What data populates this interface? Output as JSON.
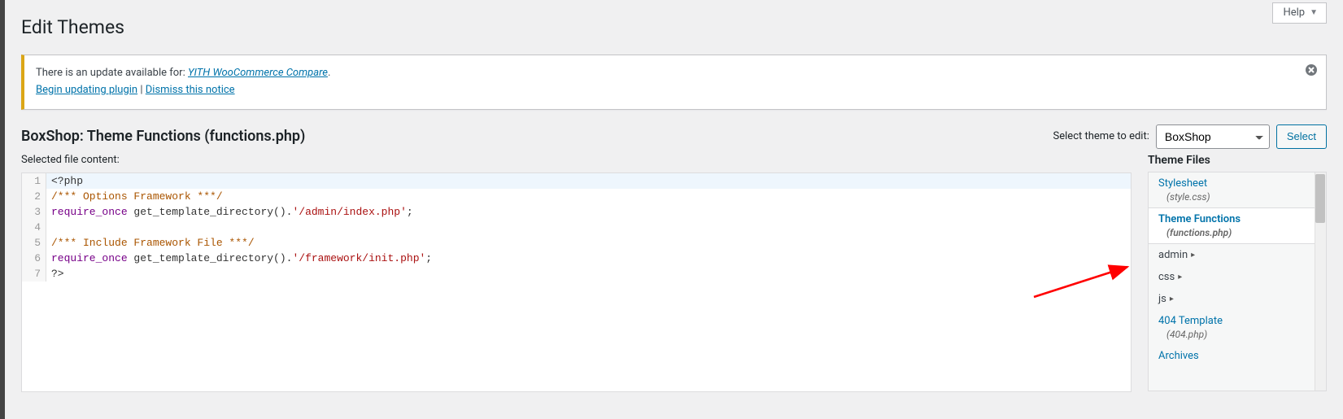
{
  "help_tab": "Help",
  "page_title": "Edit Themes",
  "notice": {
    "prefix": "There is an update available for: ",
    "plugin_name": "YITH WooCommerce Compare",
    "suffix": ".",
    "begin_link": "Begin updating plugin",
    "separator": " | ",
    "dismiss_link": "Dismiss this notice"
  },
  "file_heading": "BoxShop: Theme Functions (functions.php)",
  "theme_picker_label": "Select theme to edit:",
  "theme_selected": "BoxShop",
  "select_button": "Select",
  "selected_file_label": "Selected file content:",
  "theme_files_heading": "Theme Files",
  "code": {
    "line1": "<?php",
    "line2": "/*** Options Framework ***/",
    "line3_kw": "require_once",
    "line3_fn": " get_template_directory().",
    "line3_str": "'/admin/index.php'",
    "line3_end": ";",
    "line5": "/*** Include Framework File ***/",
    "line6_kw": "require_once",
    "line6_fn": " get_template_directory().",
    "line6_str": "'/framework/init.php'",
    "line6_end": ";",
    "line7": "?>"
  },
  "files": {
    "stylesheet": "Stylesheet",
    "stylesheet_sub": "(style.css)",
    "functions": "Theme Functions",
    "functions_sub": "(functions.php)",
    "admin": "admin",
    "css": "css",
    "js": "js",
    "tpl404": "404 Template",
    "tpl404_sub": "(404.php)",
    "archives": "Archives"
  }
}
